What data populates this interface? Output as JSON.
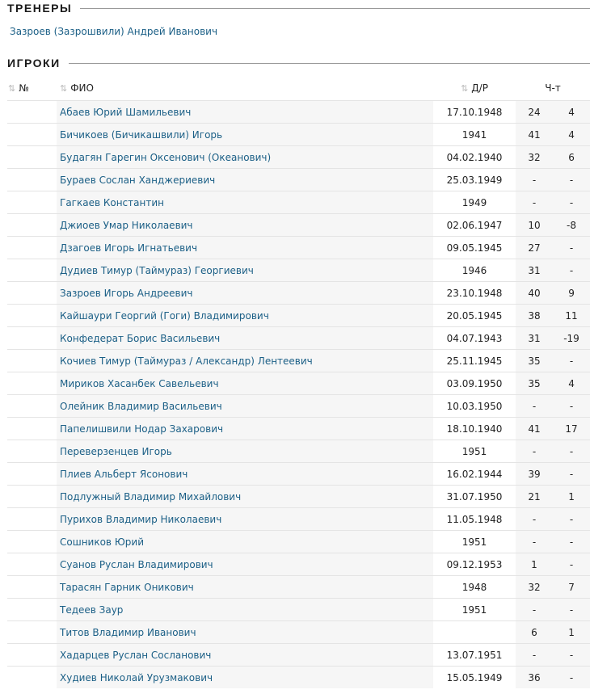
{
  "coaches": {
    "title": "ТРЕНЕРЫ",
    "items": [
      "Зазроев (Зазрошвили) Андрей Иванович"
    ]
  },
  "players": {
    "title": "ИГРОКИ",
    "headers": {
      "num": "№",
      "name": "ФИО",
      "dob": "Д/Р",
      "stats": "Ч-т"
    },
    "rows": [
      [
        "Абаев Юрий Шамильевич",
        "17.10.1948",
        "24",
        "4"
      ],
      [
        "Бичикоев (Бичикашвили) Игорь",
        "1941",
        "41",
        "4"
      ],
      [
        "Будагян Гарегин Оксенович (Океанович)",
        "04.02.1940",
        "32",
        "6"
      ],
      [
        "Бураев Сослан Ханджериевич",
        "25.03.1949",
        "-",
        "-"
      ],
      [
        "Гагкаев Константин",
        "1949",
        "-",
        "-"
      ],
      [
        "Джиоев Умар Николаевич",
        "02.06.1947",
        "10",
        "-8"
      ],
      [
        "Дзагоев Игорь Игнатьевич",
        "09.05.1945",
        "27",
        "-"
      ],
      [
        "Дудиев Тимур (Таймураз) Георгиевич",
        "1946",
        "31",
        "-"
      ],
      [
        "Зазроев Игорь Андреевич",
        "23.10.1948",
        "40",
        "9"
      ],
      [
        "Кайшаури Георгий (Гоги) Владимирович",
        "20.05.1945",
        "38",
        "11"
      ],
      [
        "Конфедерат Борис Васильевич",
        "04.07.1943",
        "31",
        "-19"
      ],
      [
        "Кочиев Тимур (Таймураз / Александр) Лентеевич",
        "25.11.1945",
        "35",
        "-"
      ],
      [
        "Мириков Хасанбек Савельевич",
        "03.09.1950",
        "35",
        "4"
      ],
      [
        "Олейник Владимир Васильевич",
        "10.03.1950",
        "-",
        "-"
      ],
      [
        "Папелишвили Нодар Захарович",
        "18.10.1940",
        "41",
        "17"
      ],
      [
        "Переверзенцев Игорь",
        "1951",
        "-",
        "-"
      ],
      [
        "Плиев Альберт Ясонович",
        "16.02.1944",
        "39",
        "-"
      ],
      [
        "Подлужный Владимир Михайлович",
        "31.07.1950",
        "21",
        "1"
      ],
      [
        "Пурихов Владимир Николаевич",
        "11.05.1948",
        "-",
        "-"
      ],
      [
        "Сошников Юрий",
        "1951",
        "-",
        "-"
      ],
      [
        "Суанов Руслан Владимирович",
        "09.12.1953",
        "1",
        "-"
      ],
      [
        "Тарасян Гарник Оникович",
        "1948",
        "32",
        "7"
      ],
      [
        "Тедеев Заур",
        "1951",
        "-",
        "-"
      ],
      [
        "Титов Владимир Иванович",
        "",
        "6",
        "1"
      ],
      [
        "Хадарцев Руслан Сосланович",
        "13.07.1951",
        "-",
        "-"
      ],
      [
        "Худиев Николай Урузмакович",
        "15.05.1949",
        "36",
        "-"
      ]
    ]
  }
}
